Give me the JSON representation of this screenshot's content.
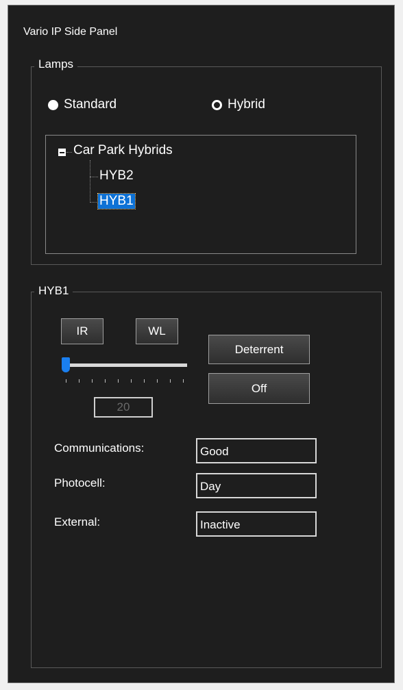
{
  "panel": {
    "title": "Vario IP Side Panel"
  },
  "lamps": {
    "label": "Lamps",
    "options": [
      {
        "label": "Standard",
        "selected": true
      },
      {
        "label": "Hybrid",
        "selected": false
      }
    ],
    "tree": {
      "root": "Car Park Hybrids",
      "children": [
        "HYB2",
        "HYB1"
      ],
      "selected": "HYB1"
    }
  },
  "detail": {
    "label": "HYB1",
    "ir_button": "IR",
    "wl_button": "WL",
    "deterrent_button": "Deterrent",
    "off_button": "Off",
    "slider_value": "20",
    "fields": {
      "communications_label": "Communications:",
      "communications_value": "Good",
      "photocell_label": "Photocell:",
      "photocell_value": "Day",
      "external_label": "External:",
      "external_value": "Inactive"
    }
  },
  "colors": {
    "background": "#1e1e1e",
    "selection": "#0e72d6",
    "slider_thumb": "#1a7ff0"
  }
}
